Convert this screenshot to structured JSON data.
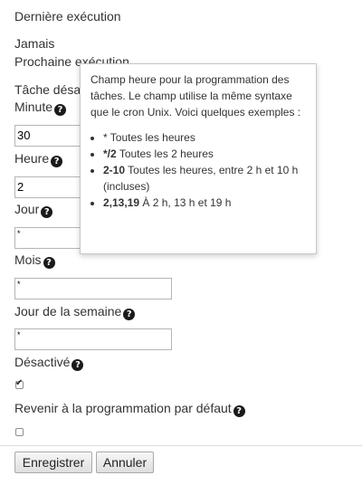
{
  "last_run": {
    "label": "Dernière exécution",
    "value": "Jamais"
  },
  "next_run": {
    "label": "Prochaine exécution"
  },
  "task_disabled": {
    "label": "Tâche désa"
  },
  "minute": {
    "label": "Minute",
    "value": "30"
  },
  "hour": {
    "label": "Heure",
    "value": "2"
  },
  "day": {
    "label": "Jour",
    "value": "*"
  },
  "month": {
    "label": "Mois",
    "value": "*"
  },
  "weekday": {
    "label": "Jour de la semaine",
    "value": "*"
  },
  "disabled": {
    "label": "Désactivé",
    "checked": true
  },
  "reset_default": {
    "label": "Revenir à la programmation par défaut",
    "checked": false
  },
  "buttons": {
    "save": "Enregistrer",
    "cancel": "Annuler"
  },
  "help_icon": "question-circle-icon",
  "tooltip": {
    "intro": "Champ heure pour la programmation des tâches. Le champ utilise la même syntaxe que le cron Unix. Voici quelques exemples :",
    "items": [
      {
        "code": "*",
        "text": "Toutes les heures"
      },
      {
        "code": "*/2",
        "text": "Toutes les 2 heures"
      },
      {
        "code": "2-10",
        "text": "Toutes les heures, entre 2 h et 10 h (incluses)"
      },
      {
        "code": "2,13,19",
        "text": "À 2 h, 13 h et 19 h"
      }
    ]
  }
}
